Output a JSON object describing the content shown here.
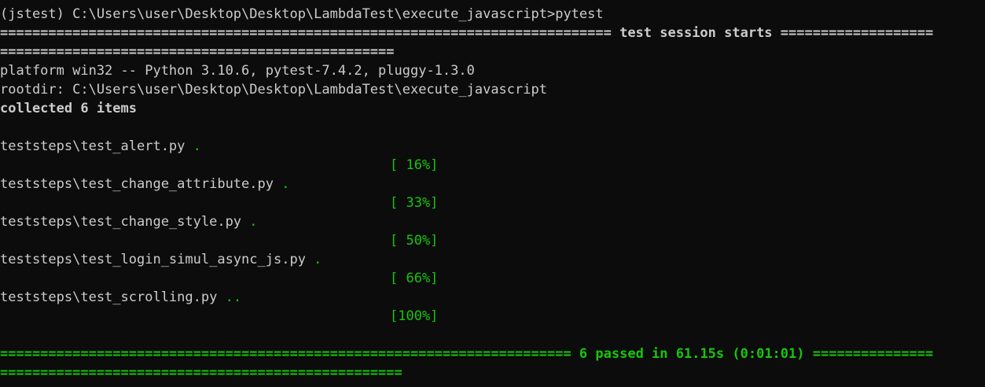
{
  "terminal": {
    "prompt": "(jstest) C:\\Users\\user\\Desktop\\Desktop\\LambdaTest\\execute_javascript>pytest",
    "session_line1": "============================================================================ test session starts ===================",
    "session_line2": "=================================================",
    "platform": "platform win32 -- Python 3.10.6, pytest-7.4.2, pluggy-1.3.0",
    "rootdir": "rootdir: C:\\Users\\user\\Desktop\\Desktop\\LambdaTest\\execute_javascript",
    "collected": "collected 6 items",
    "tests": [
      {
        "file": "teststeps\\test_alert.py ",
        "dots": ".",
        "percent": "[ 16%]"
      },
      {
        "file": "teststeps\\test_change_attribute.py ",
        "dots": ".",
        "percent": "[ 33%]"
      },
      {
        "file": "teststeps\\test_change_style.py ",
        "dots": ".",
        "percent": "[ 50%]"
      },
      {
        "file": "teststeps\\test_login_simul_async_js.py ",
        "dots": ".",
        "percent": "[ 66%]"
      },
      {
        "file": "teststeps\\test_scrolling.py ",
        "dots": "..",
        "percent": "[100%]"
      }
    ],
    "summary_line1_left": "======================================================================= ",
    "summary_text": "6 passed in 61.15s (0:01:01)",
    "summary_line1_right": " ===============",
    "summary_line2": "=================================================="
  },
  "colors": {
    "background": "#0c0c0c",
    "text": "#cccccc",
    "pass_green": "#16c60c"
  }
}
